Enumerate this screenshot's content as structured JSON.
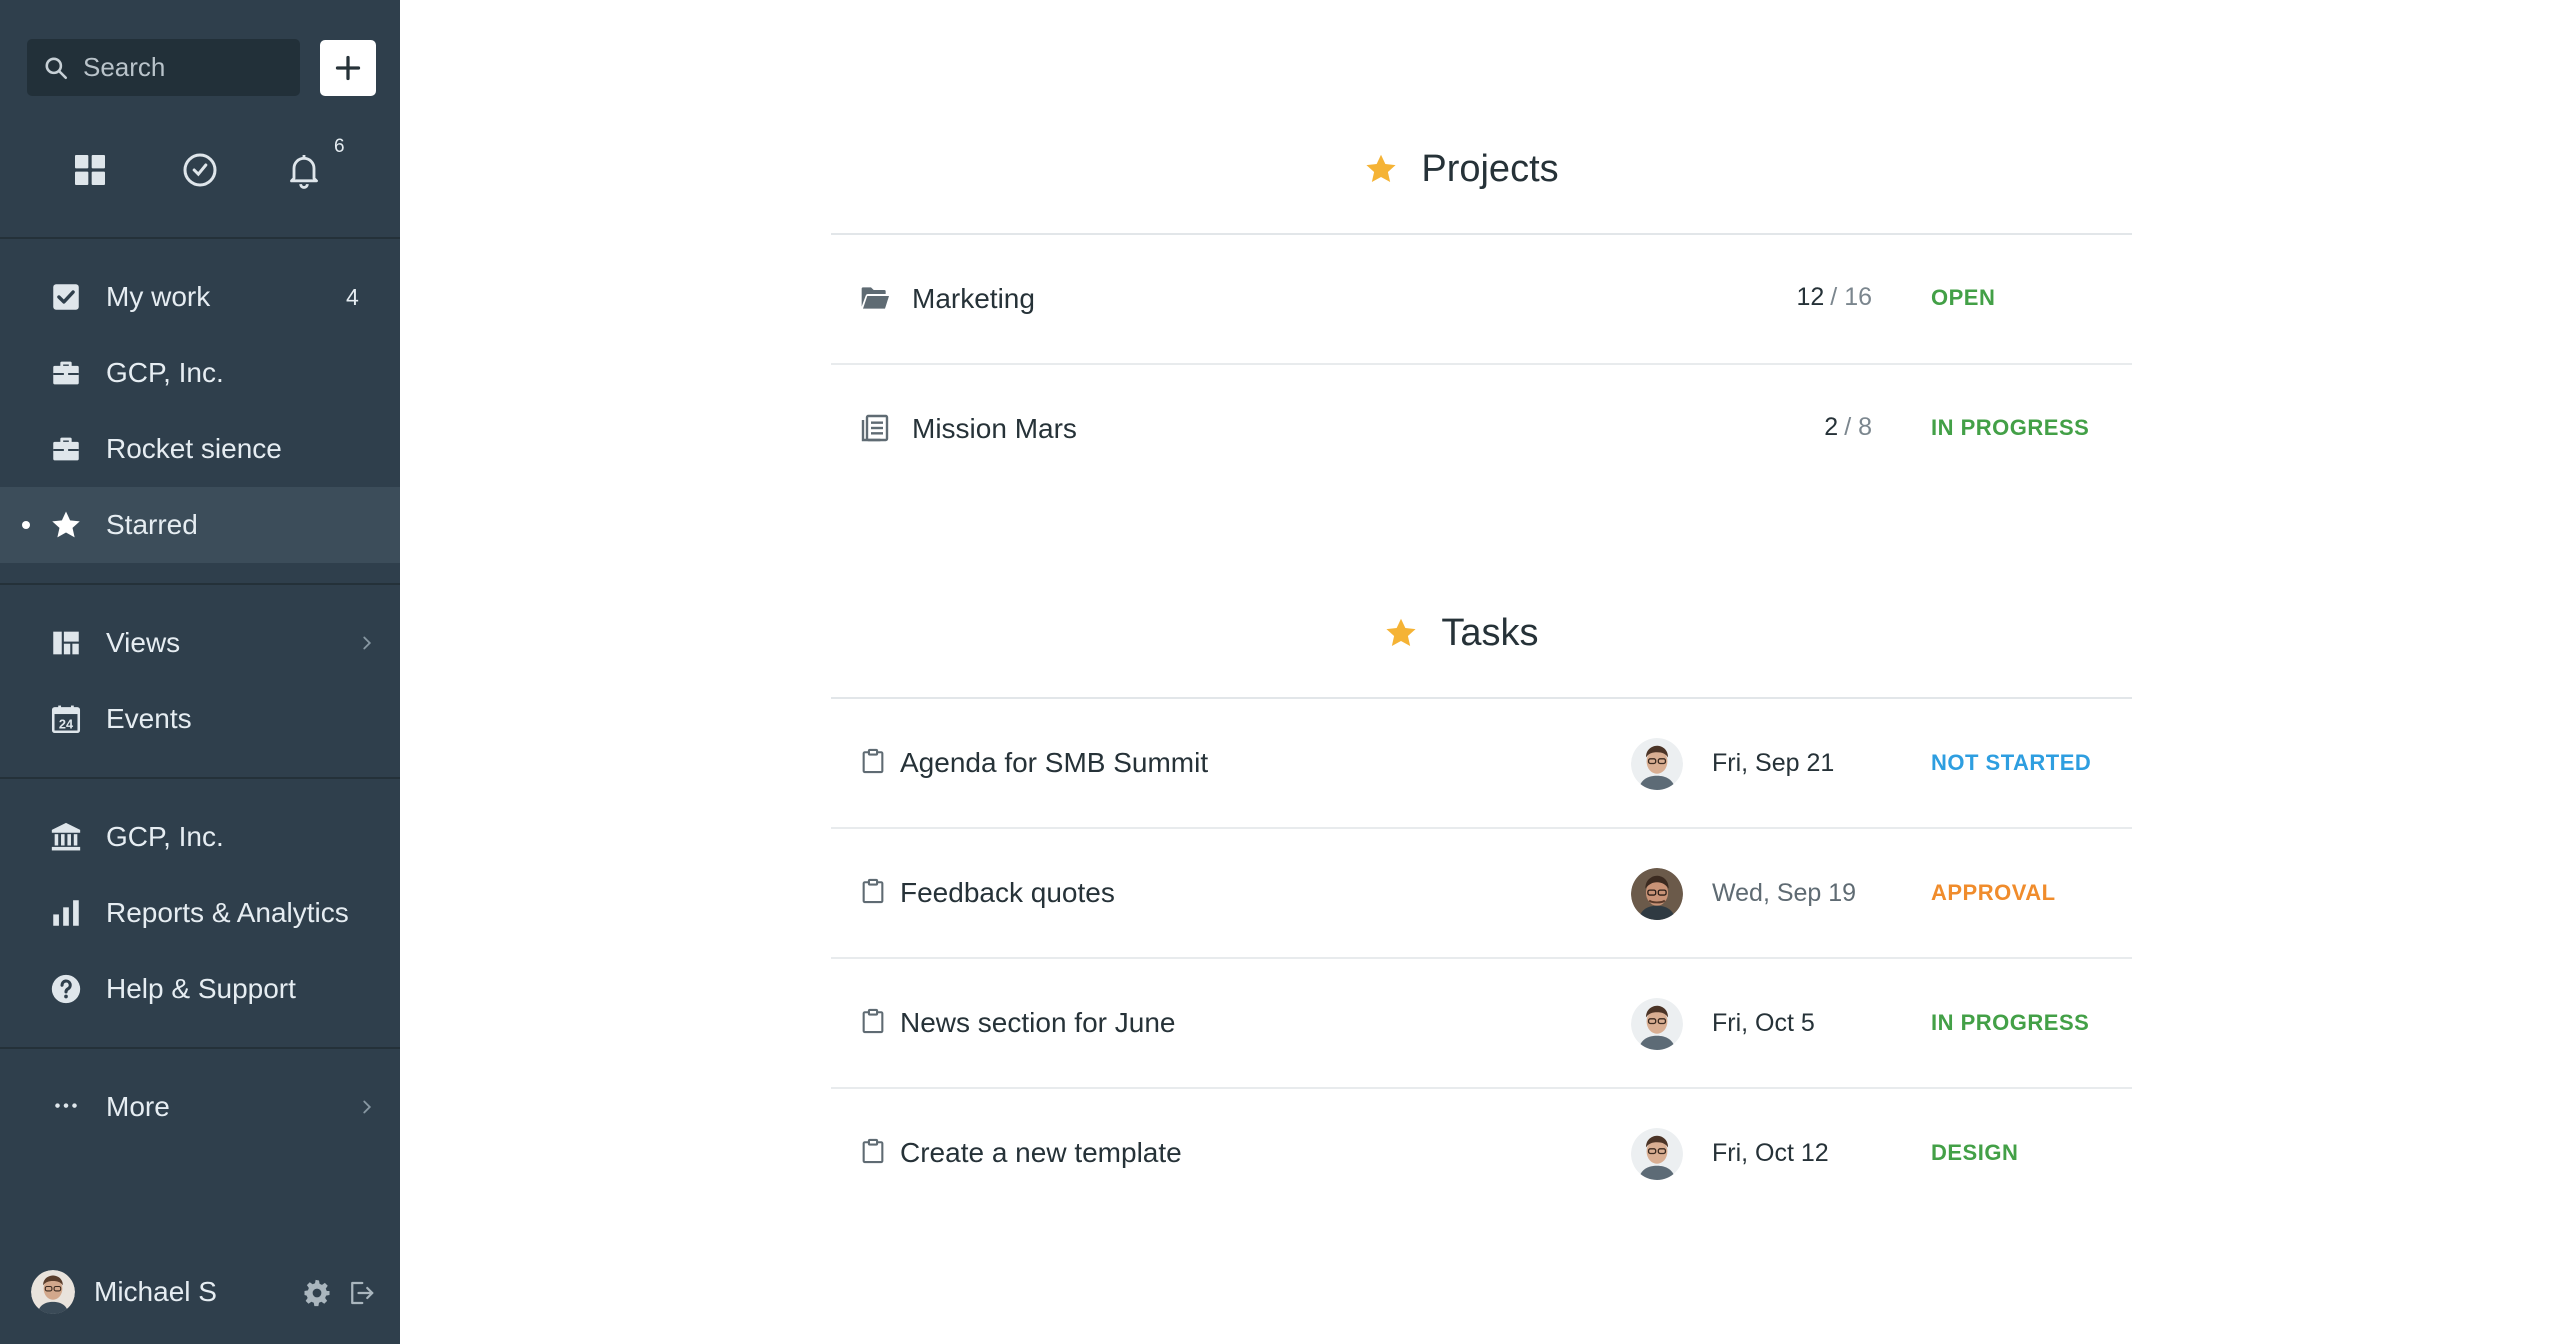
{
  "sidebar": {
    "search": {
      "placeholder": "Search"
    },
    "notifications": {
      "count": "6"
    },
    "nav_primary": [
      {
        "label": "My work",
        "count": "4",
        "icon": "checkbox-icon"
      },
      {
        "label": "GCP, Inc.",
        "icon": "briefcase-icon"
      },
      {
        "label": "Rocket sience",
        "icon": "briefcase-icon"
      },
      {
        "label": "Starred",
        "icon": "star-icon",
        "active": true
      }
    ],
    "nav_secondary": [
      {
        "label": "Views",
        "icon": "views-icon"
      },
      {
        "label": "Events",
        "icon": "calendar-icon",
        "calendar_day": "24"
      }
    ],
    "nav_tertiary": [
      {
        "label": "GCP, Inc.",
        "icon": "bank-icon"
      },
      {
        "label": "Reports & Analytics",
        "icon": "bar-chart-icon"
      },
      {
        "label": "Help & Support",
        "icon": "help-icon"
      }
    ],
    "more": {
      "label": "More",
      "icon": "ellipsis-icon"
    },
    "user": {
      "name": "Michael S"
    }
  },
  "main": {
    "projects": {
      "title": "Projects",
      "items": [
        {
          "name": "Marketing",
          "done": "12",
          "total": "/ 16",
          "status": "OPEN",
          "status_color": "#43a047",
          "icon": "folder-open-icon"
        },
        {
          "name": "Mission Mars",
          "done": "2",
          "total": "/ 8",
          "status": "IN PROGRESS",
          "status_color": "#43a047",
          "icon": "project-icon"
        }
      ]
    },
    "tasks": {
      "title": "Tasks",
      "items": [
        {
          "name": "Agenda for SMB Summit",
          "due": "Fri, Sep 21",
          "status": "NOT STARTED",
          "status_color": "#2e9ee0",
          "avatar": "light"
        },
        {
          "name": "Feedback quotes",
          "due": "Wed, Sep 19",
          "status": "APPROVAL",
          "status_color": "#f08c2c",
          "avatar": "dark"
        },
        {
          "name": "News section for June",
          "due": "Fri, Oct 5",
          "status": "IN PROGRESS",
          "status_color": "#43a047",
          "avatar": "light"
        },
        {
          "name": "Create a new template",
          "due": "Fri, Oct 12",
          "status": "DESIGN",
          "status_color": "#43a047",
          "avatar": "light"
        }
      ]
    },
    "colors": {
      "star": "#f5b335",
      "sidebar_bg": "#2f3f4c",
      "active_bg": "#3c4d5a"
    }
  }
}
